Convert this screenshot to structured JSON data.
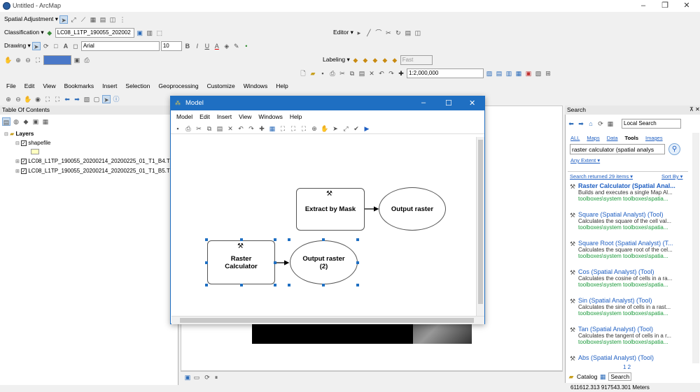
{
  "window": {
    "title": "Untitled - ArcMap"
  },
  "toolbars": {
    "spatial_adjustment": "Spatial Adjustment ▾",
    "classification": "Classification ▾",
    "classification_layer": "LC08_L1TP_190055_202002",
    "editor": "Editor ▾",
    "drawing": "Drawing ▾",
    "font": "Arial",
    "font_size": "10",
    "labeling": "Labeling ▾",
    "fast": "Fast",
    "scale": "1:2,000,000"
  },
  "menu": [
    "File",
    "Edit",
    "View",
    "Bookmarks",
    "Insert",
    "Selection",
    "Geoprocessing",
    "Customize",
    "Windows",
    "Help"
  ],
  "toc": {
    "title": "Table Of Contents",
    "layers_label": "Layers",
    "items": [
      "shapefile",
      "LC08_L1TP_190055_20200214_20200225_01_T1_B4.T",
      "LC08_L1TP_190055_20200214_20200225_01_T1_B5.T"
    ]
  },
  "model": {
    "title": "Model",
    "menu": [
      "Model",
      "Edit",
      "Insert",
      "View",
      "Windows",
      "Help"
    ],
    "nodes": {
      "extract": "Extract by Mask",
      "output1": "Output raster",
      "raster_calc": "Raster\nCalculator",
      "output2": "Output raster\n(2)"
    }
  },
  "search": {
    "title": "Search",
    "scope": "Local Search",
    "tabs": [
      "ALL",
      "Maps",
      "Data",
      "Tools",
      "Images"
    ],
    "query": "raster calculator (spatial analys",
    "any_extent": "Any Extent ▾",
    "returned": "Search returned 29 items ▾",
    "sort_by": "Sort By ▾",
    "results": [
      {
        "title": "Raster Calculator (Spatial Anal...",
        "desc": "Builds and executes a single Map Al...",
        "path": "toolboxes\\system toolboxes\\spatia..."
      },
      {
        "title": "Square (Spatial Analyst) (Tool)",
        "desc": "Calculates the square of the cell val...",
        "path": "toolboxes\\system toolboxes\\spatia..."
      },
      {
        "title": "Square Root (Spatial Analyst) (T...",
        "desc": "Calculates the square root of the cel...",
        "path": "toolboxes\\system toolboxes\\spatia..."
      },
      {
        "title": "Cos (Spatial Analyst) (Tool)",
        "desc": "Calculates the cosine of cells in a ra...",
        "path": "toolboxes\\system toolboxes\\spatia..."
      },
      {
        "title": "Sin (Spatial Analyst) (Tool)",
        "desc": "Calculates the sine of cells in a rast...",
        "path": "toolboxes\\system toolboxes\\spatia..."
      },
      {
        "title": "Tan (Spatial Analyst) (Tool)",
        "desc": "Calculates the tangent of cells in a r...",
        "path": "toolboxes\\system toolboxes\\spatia..."
      },
      {
        "title": "Abs (Spatial Analyst) (Tool)",
        "desc": "",
        "path": ""
      }
    ],
    "pages": "1 2",
    "bottom_tabs": [
      "Catalog",
      "Search"
    ]
  },
  "status": {
    "coords": "611612.313  917543.301 Meters"
  }
}
